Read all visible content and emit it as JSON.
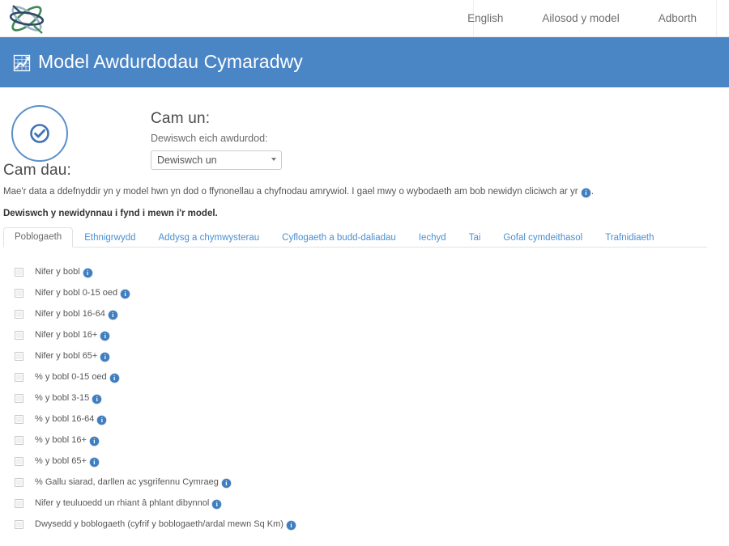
{
  "nav": {
    "logo_icon": "orbital-logo-icon",
    "links": [
      {
        "label": "English",
        "name": "nav-link-english"
      },
      {
        "label": "Ailosod y model",
        "name": "nav-link-reset-model"
      },
      {
        "label": "Adborth",
        "name": "nav-link-feedback"
      }
    ]
  },
  "banner": {
    "icon": "line-chart-icon",
    "title": "Model Awdurdodau Cymaradwy",
    "color": "#4a85c6"
  },
  "step_one": {
    "circle_icon": "check-circle-icon",
    "heading": "Cam un:",
    "sublabel": "Dewiswch eich awdurdod:",
    "select": {
      "value": "Dewiswch un",
      "options": [
        "Dewiswch un"
      ]
    }
  },
  "step_two": {
    "heading": "Cam dau:",
    "paragraph_before_icon": "Mae'r data a ddefnyddir yn y model hwn yn dod o ffynonellau a chyfnodau amrywiol. I gael mwy o wybodaeth am bob newidyn cliciwch ar yr",
    "paragraph_after_icon": ".",
    "instruction": "Dewiswch y newidynnau i fynd i mewn i'r model.",
    "info_icon_glyph": "i"
  },
  "tabs": [
    {
      "label": "Poblogaeth",
      "name": "tab-poblogaeth",
      "active": true
    },
    {
      "label": "Ethnigrwydd",
      "name": "tab-ethnigrwydd",
      "active": false
    },
    {
      "label": "Addysg a chymwysterau",
      "name": "tab-addysg-a-chymwysterau",
      "active": false
    },
    {
      "label": "Cyflogaeth a budd-daliadau",
      "name": "tab-cyflogaeth-a-budd-daliadau",
      "active": false
    },
    {
      "label": "Iechyd",
      "name": "tab-iechyd",
      "active": false
    },
    {
      "label": "Tai",
      "name": "tab-tai",
      "active": false
    },
    {
      "label": "Gofal cymdeithasol",
      "name": "tab-gofal-cymdeithasol",
      "active": false
    },
    {
      "label": "Trafnidiaeth",
      "name": "tab-trafnidiaeth",
      "active": false
    }
  ],
  "variables": [
    {
      "label": "Nifer y bobl",
      "checked": false
    },
    {
      "label": "Nifer y bobl 0-15 oed",
      "checked": false
    },
    {
      "label": "Nifer y bobl 16-64",
      "checked": false
    },
    {
      "label": "Nifer y bobl 16+",
      "checked": false
    },
    {
      "label": "Nifer y bobl 65+",
      "checked": false
    },
    {
      "label": "% y bobl 0-15 oed",
      "checked": false
    },
    {
      "label": "% y bobl 3-15",
      "checked": false
    },
    {
      "label": "% y bobl 16-64",
      "checked": false
    },
    {
      "label": "% y bobl 16+",
      "checked": false
    },
    {
      "label": "% y bobl 65+",
      "checked": false
    },
    {
      "label": "% Gallu siarad, darllen ac ysgrifennu Cymraeg",
      "checked": false
    },
    {
      "label": "Nifer y teuluoedd un rhiant â phlant dibynnol",
      "checked": false
    },
    {
      "label": "Dwysedd y boblogaeth (cyfrif y boblogaeth/ardal mewn Sq Km)",
      "checked": false
    }
  ],
  "colors": {
    "banner_blue": "#4a85c6",
    "link_blue": "#4a8fd1",
    "info_blue": "#3f7fc1",
    "step_circle_blue": "#5b8fc9"
  }
}
